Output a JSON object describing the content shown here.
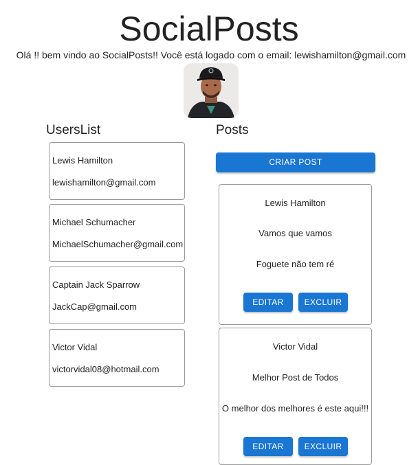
{
  "header": {
    "title": "SocialPosts",
    "welcome": "Olá !! bem vindo ao SocialPosts!! Você está logado com o email: lewishamilton@gmail.com"
  },
  "users_section": {
    "title": "UsersList",
    "users": [
      {
        "name": "Lewis Hamilton",
        "email": "lewishamilton@gmail.com"
      },
      {
        "name": "Michael Schumacher",
        "email": "MichaelSchumacher@gmail.com"
      },
      {
        "name": "Captain Jack Sparrow",
        "email": "JackCap@gmail.com"
      },
      {
        "name": "Victor Vidal",
        "email": "victorvidal08@hotmail.com"
      }
    ]
  },
  "posts_section": {
    "title": "Posts",
    "create_label": "CRIAR POST",
    "posts": [
      {
        "author": "Lewis Hamilton",
        "title": "Vamos que vamos",
        "body": "Foguete não tem ré",
        "edit_label": "EDITAR",
        "delete_label": "EXCLUIR"
      },
      {
        "author": "Victor Vidal",
        "title": "Melhor Post de Todos",
        "body": "O melhor dos melhores é este aqui!!!",
        "edit_label": "EDITAR",
        "delete_label": "EXCLUIR"
      }
    ]
  },
  "colors": {
    "primary": "#1976d2",
    "card_border": "#9a9a9a",
    "text": "#222222"
  }
}
